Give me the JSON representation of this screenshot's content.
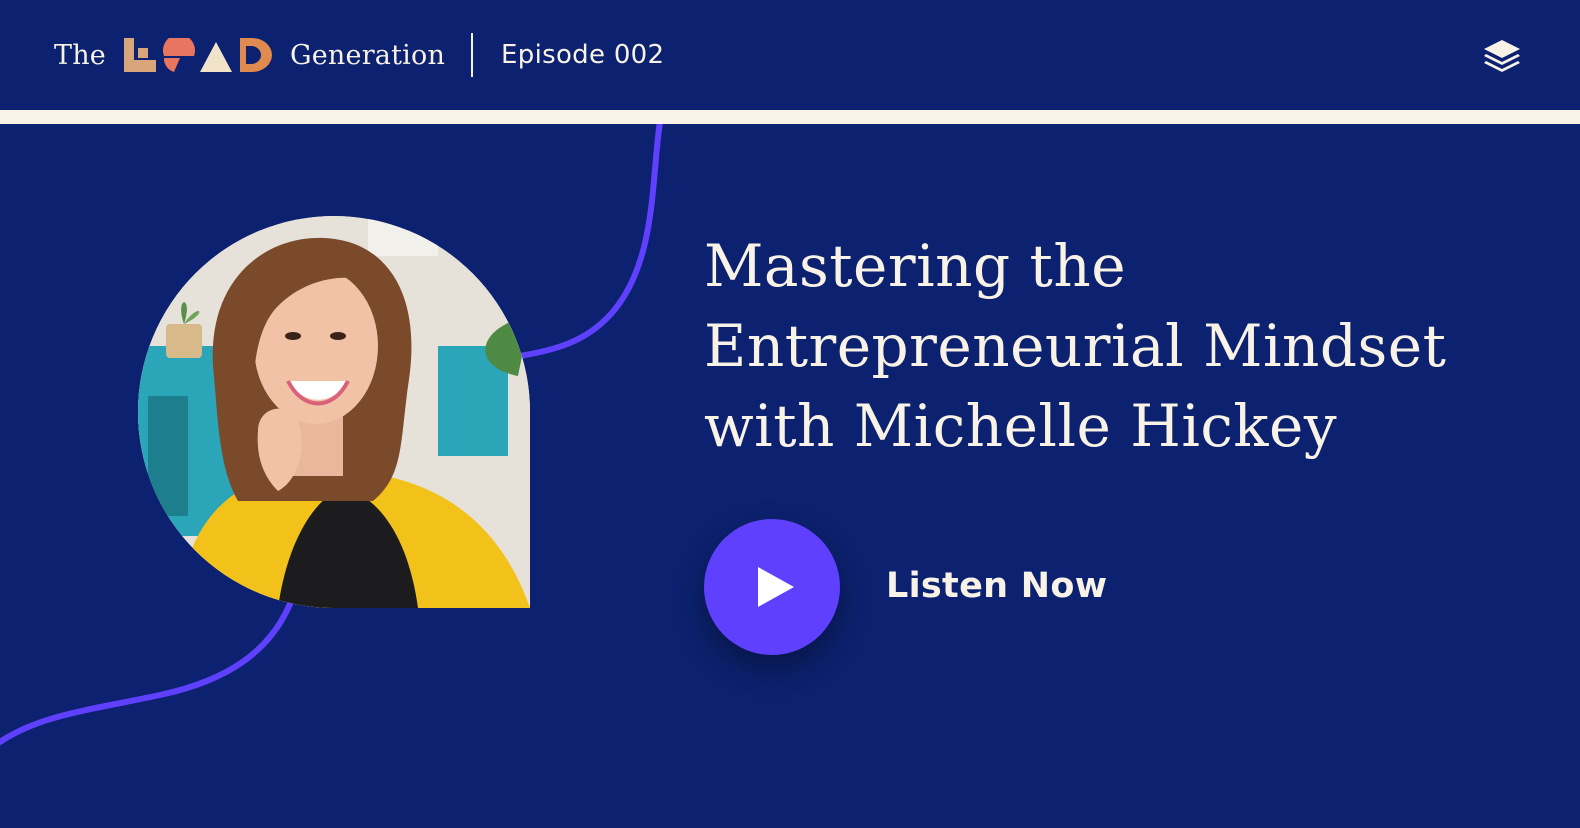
{
  "header": {
    "brand_prefix": "The",
    "brand_logo_word": "LEAD",
    "brand_suffix": "Generation",
    "episode_label": "Episode 002",
    "right_icon": "layers-icon"
  },
  "hero": {
    "title_lines": [
      "Mastering the",
      "Entrepreneurial Mindset",
      "with Michelle Hickey"
    ],
    "cta": {
      "icon": "play-icon",
      "label": "Listen Now"
    },
    "photo_alt": "Michelle Hickey portrait"
  },
  "colors": {
    "background": "#0c216f",
    "cream": "#f8f3e6",
    "accent_purple": "#5f40ff",
    "logo_tan": "#d9a57a",
    "logo_coral": "#e8755f",
    "logo_cream": "#f1e3c8",
    "logo_orange": "#e08a4f"
  }
}
